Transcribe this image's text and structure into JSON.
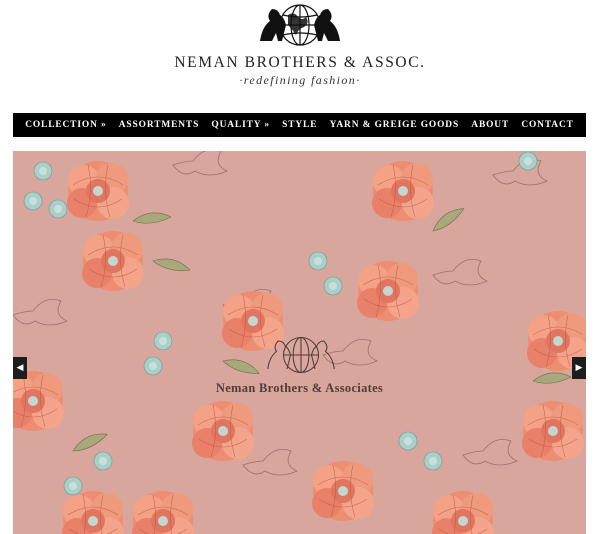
{
  "brand": {
    "name": "NEMAN BROTHERS & ASSOC.",
    "tagline": "·redefining fashion·"
  },
  "nav": {
    "items": [
      {
        "label": "COLLECTION »"
      },
      {
        "label": "ASSORTMENTS"
      },
      {
        "label": "QUALITY »"
      },
      {
        "label": "STYLE"
      },
      {
        "label": "YARN & GREIGE GOODS"
      },
      {
        "label": "ABOUT"
      },
      {
        "label": "CONTACT"
      }
    ]
  },
  "slider": {
    "watermark_text": "Neman Brothers & Associates",
    "prev_icon": "◀",
    "next_icon": "▶",
    "background_color": "#d8a69c",
    "flower_color": "#ef8c6e",
    "leaf_color": "#a9a87c",
    "accent_flower_color": "#a9cfc8"
  },
  "colors": {
    "nav_background": "#000000",
    "nav_text": "#ffffff"
  }
}
